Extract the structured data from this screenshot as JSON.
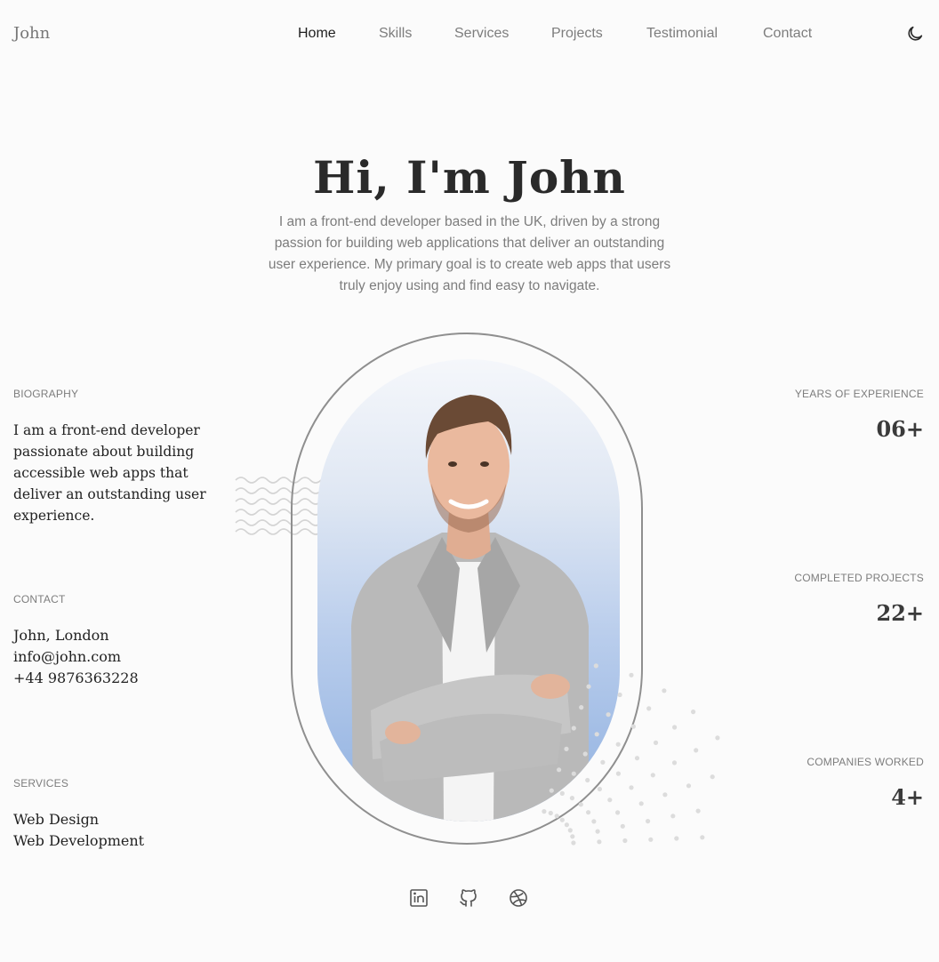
{
  "header": {
    "logo": "John",
    "nav": [
      {
        "label": "Home",
        "active": true
      },
      {
        "label": "Skills",
        "active": false
      },
      {
        "label": "Services",
        "active": false
      },
      {
        "label": "Projects",
        "active": false
      },
      {
        "label": "Testimonial",
        "active": false
      },
      {
        "label": "Contact",
        "active": false
      }
    ],
    "theme_icon": "moon-icon"
  },
  "hero": {
    "title": "Hi, I'm John",
    "description": "I am a front-end developer based in the UK, driven by a strong passion for building web applications that deliver an outstanding user experience. My primary goal is to create web apps that users truly enjoy using and find easy to navigate."
  },
  "left": {
    "biography": {
      "label": "BIOGRAPHY",
      "text": "I am a front-end developer passionate about building accessible web apps that deliver an outstanding user experience."
    },
    "contact": {
      "label": "CONTACT",
      "lines": [
        "John, London",
        "info@john.com",
        "+44 9876363228"
      ]
    },
    "services": {
      "label": "SERVICES",
      "lines": [
        "Web Design",
        "Web Development"
      ]
    }
  },
  "right": {
    "stats": [
      {
        "label": "YEARS OF EXPERIENCE",
        "value": "06+"
      },
      {
        "label": "COMPLETED PROJECTS",
        "value": "22+"
      },
      {
        "label": "COMPANIES WORKED",
        "value": "4+"
      }
    ]
  },
  "social": [
    {
      "icon": "linkedin-icon"
    },
    {
      "icon": "github-icon"
    },
    {
      "icon": "dribbble-icon"
    }
  ],
  "colors": {
    "background": "#fbfbfb",
    "text": "#2a2a2a",
    "muted": "#7d7d7d",
    "photo_blue": "#8fb0e0"
  }
}
